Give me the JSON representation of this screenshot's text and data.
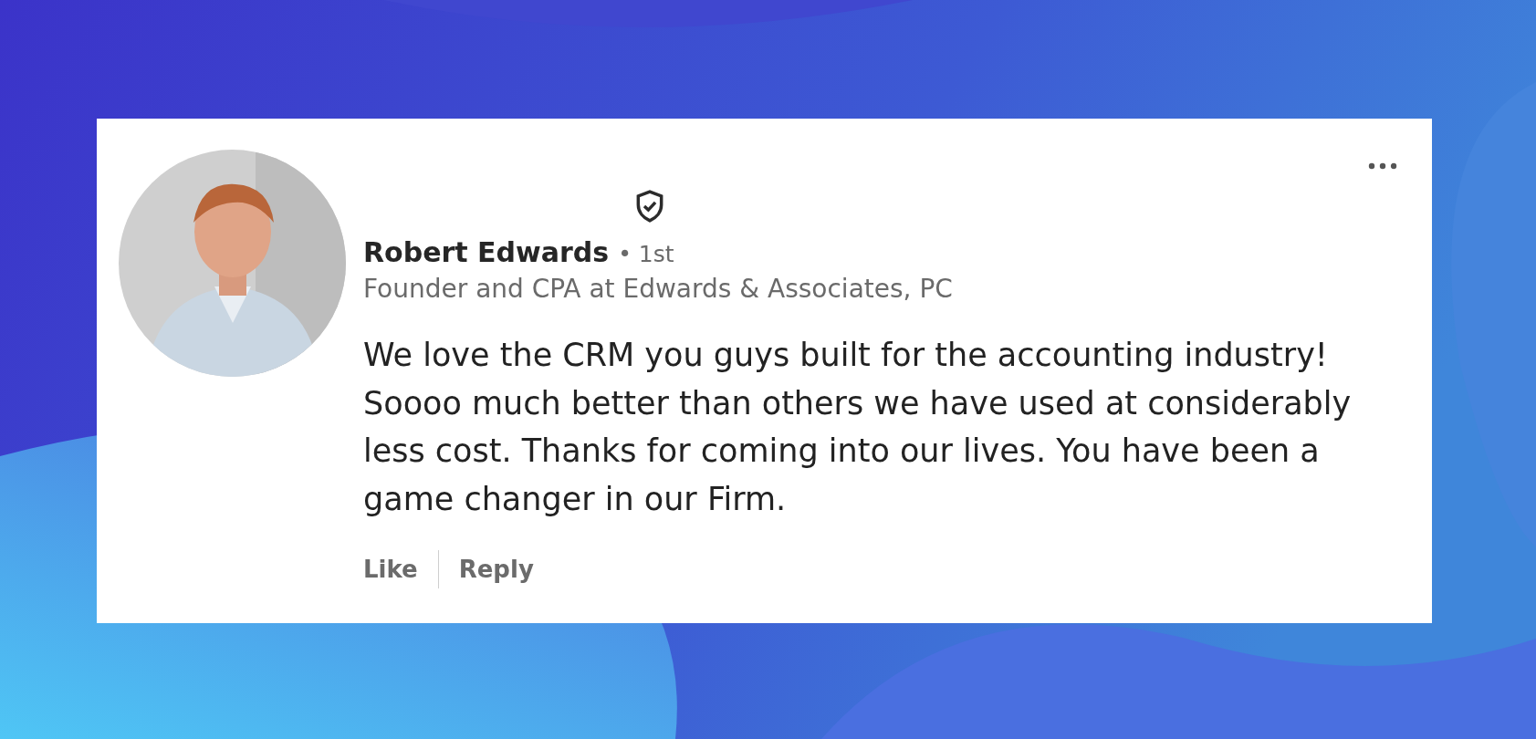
{
  "comment": {
    "author": {
      "name": "Robert Edwards",
      "degree": "• 1st",
      "headline": "Founder and CPA at Edwards & Associates, PC",
      "verified": true
    },
    "text": "We love the CRM you guys built for the accounting industry! Soooo much better than others we have used at considerably less cost. Thanks for coming into our lives. You have been a game changer in our Firm.",
    "actions": [
      {
        "label": "Like"
      },
      {
        "label": "Reply"
      }
    ]
  }
}
